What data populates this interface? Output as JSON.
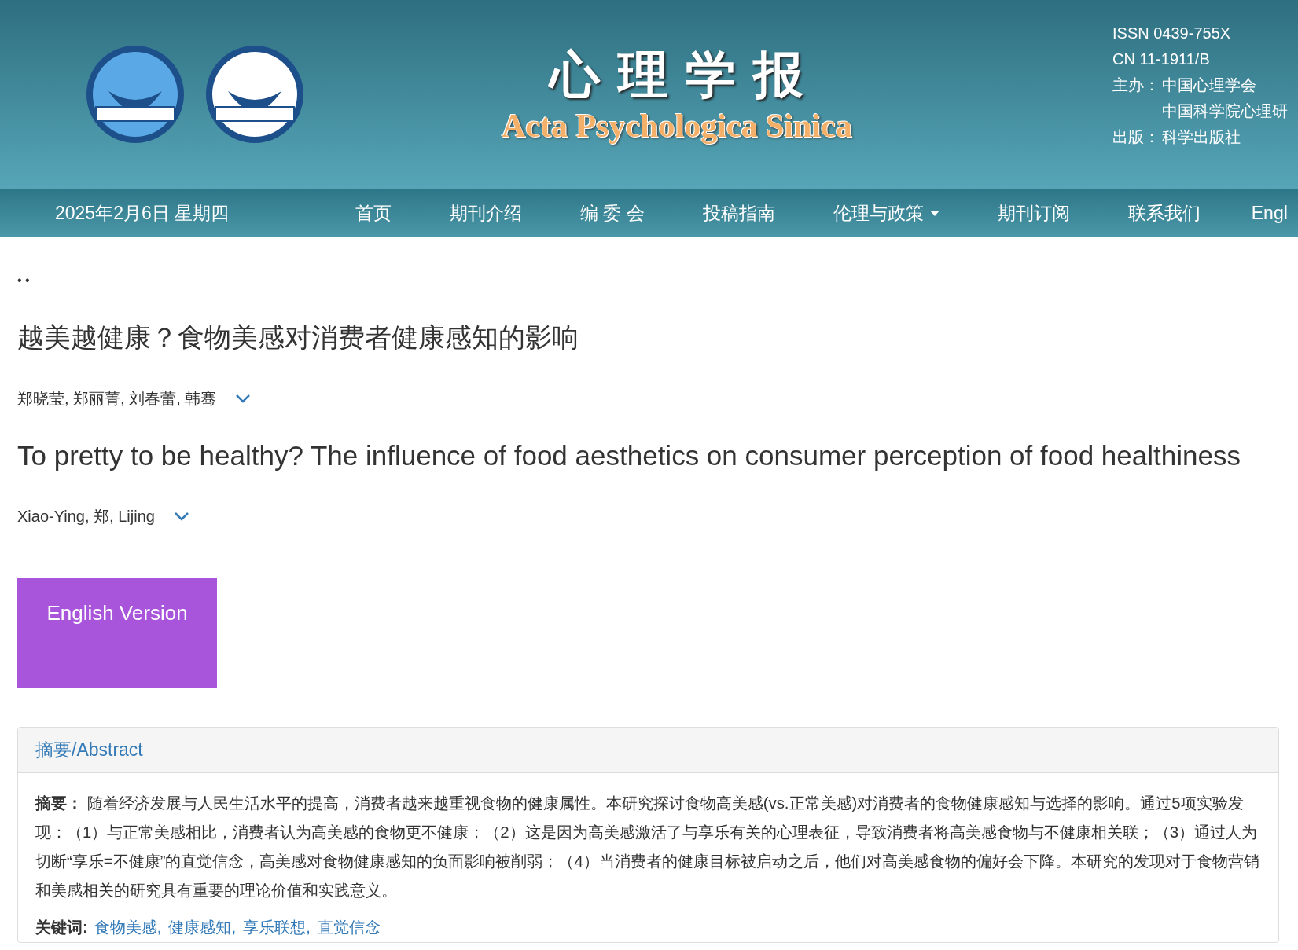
{
  "header": {
    "title_cn": "心 理 学 报",
    "title_en": "Acta Psychologica Sinica",
    "info": [
      {
        "label": "ISSN 0439-755X"
      },
      {
        "label": "CN 11-1911/B"
      },
      {
        "label": "主办：",
        "value": "中国心理学会"
      },
      {
        "value": "中国科学院心理研"
      },
      {
        "label": "出版：",
        "value": "科学出版社"
      }
    ]
  },
  "nav": {
    "date": "2025年2月6日 星期四",
    "items": [
      {
        "label": "首页",
        "dropdown": false
      },
      {
        "label": "期刊介绍",
        "dropdown": false
      },
      {
        "label": "编 委 会",
        "dropdown": false
      },
      {
        "label": "投稿指南",
        "dropdown": false
      },
      {
        "label": "伦理与政策",
        "dropdown": true
      },
      {
        "label": "期刊订阅",
        "dropdown": false
      },
      {
        "label": "联系我们",
        "dropdown": false
      },
      {
        "label": "Engl",
        "dropdown": false
      }
    ]
  },
  "breadcrumb": "• •",
  "title_cn": "越美越健康？食物美感对消费者健康感知的影响",
  "authors_cn": "郑晓莹, 郑丽菁, 刘春蕾, 韩骞",
  "title_en": "To pretty to be healthy? The influence of food aesthetics on consumer perception of food healthiness",
  "authors_en": "Xiao-Ying, 郑, Lijing",
  "english_button": "English Version",
  "abstract": {
    "heading": "摘要/Abstract",
    "label": "摘要：",
    "text": "随着经济发展与人民生活水平的提高，消费者越来越重视食物的健康属性。本研究探讨食物高美感(vs.正常美感)对消费者的食物健康感知与选择的影响。通过5项实验发现：（1）与正常美感相比，消费者认为高美感的食物更不健康；（2）这是因为高美感激活了与享乐有关的心理表征，导致消费者将高美感食物与不健康相关联；（3）通过人为切断“享乐=不健康”的直觉信念，高美感对食物健康感知的负面影响被削弱；（4）当消费者的健康目标被启动之后，他们对高美感食物的偏好会下降。本研究的发现对于食物营销和美感相关的研究具有重要的理论价值和实践意义。",
    "keywords_label": "关键词:",
    "keywords": [
      "食物美感,",
      "健康感知,",
      "享乐联想,",
      "直觉信念"
    ]
  }
}
